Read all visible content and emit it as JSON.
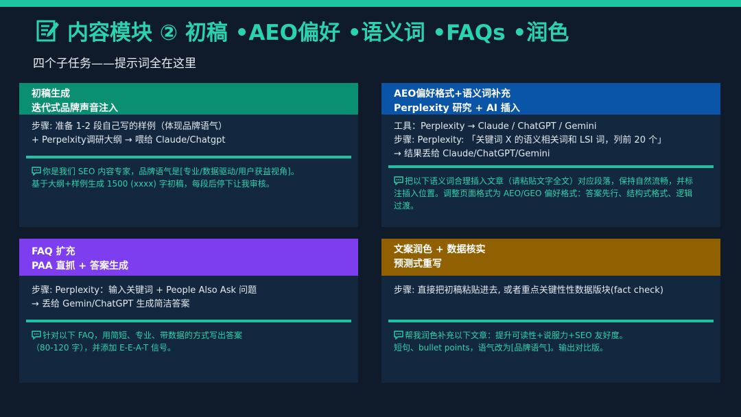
{
  "title": "内容模块 ② 初稿 •AEO偏好 •语义词 •FAQs •润色",
  "subtitle": "四个子任务——提示词全在这里",
  "colors": {
    "accent": "#1ec3a3",
    "background": "#0f1b2a",
    "card": "#13283f",
    "card1_header": "#0b8f73",
    "card2_header": "#0b55a8",
    "card3_header": "#7d3ef0",
    "card4_header": "#916000"
  },
  "cards": [
    {
      "header": [
        "初稿生成",
        "迭代式品牌声音注入"
      ],
      "steps": [
        "步骤: 准备 1-2 段自己写的样例（体现品牌语气）",
        "+ Perpelxity调研大纲 → 喂给 Claude/Chatgpt"
      ],
      "prompt": [
        "你是我们 SEO 内容专家，品牌语气是[专业/数据驱动/用户获益视角]。",
        "基于大纲+样例生成 1500 (xxxx) 字初稿，每段后停下让我审核。"
      ]
    },
    {
      "header": [
        "AEO偏好格式+语义词补充",
        "Perplexity 研究 + AI 插入"
      ],
      "steps": [
        "工具：Perplexity → Claude / ChatGPT / Gemini",
        "步骤: Perplexity: 「关键词 X 的语义相关词和 LSI 词，列前 20 个」",
        "→ 结果丢给 Claude/ChatGPT/Gemini"
      ],
      "prompt": [
        "把以下语义词合理插入文章（请粘贴文字全文）对应段落，保持自然流畅，并标",
        "注插入位置。调整页面格式为 AEO/GEO 偏好格式：答案先行、结构式格式、逻辑",
        "过渡。"
      ]
    },
    {
      "header": [
        "FAQ 扩充",
        "PAA 直抓 + 答案生成"
      ],
      "steps": [
        "步骤: Perplexity：输入关键词 + People Also Ask 问题",
        "→ 丢给 Gemin/ChatGPT 生成简洁答案"
      ],
      "prompt": [
        "针对以下 FAQ，用简短、专业、带数据的方式写出答案",
        "（80-120 字），并添加 E-E-A-T 信号。"
      ]
    },
    {
      "header": [
        "文案润色 + 数据核实",
        "预测式重写"
      ],
      "steps": [
        "步骤: 直接把初稿粘贴进去, 或者重点关键性性数据版块(fact check)"
      ],
      "prompt": [
        "帮我润色补充以下文章：提升可读性+说服力+SEO 友好度。",
        "短句、bullet points，语气改为[品牌语气]。输出对比版。"
      ]
    }
  ]
}
